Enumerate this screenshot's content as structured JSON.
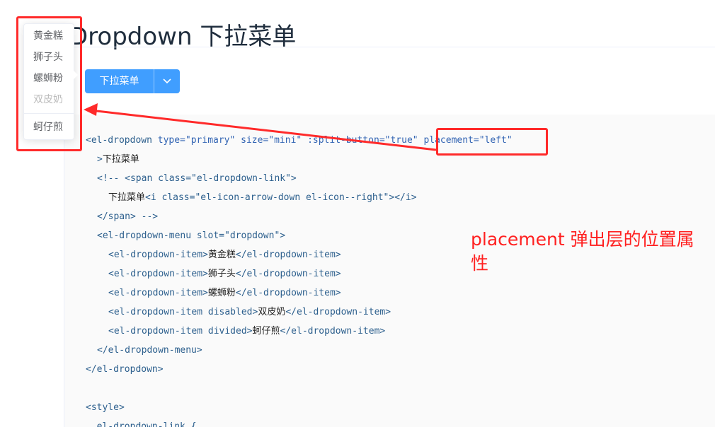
{
  "page": {
    "title": "Dropdown 下拉菜单"
  },
  "button": {
    "label": "下拉菜单"
  },
  "dropdown": {
    "items": [
      {
        "label": "黄金糕"
      },
      {
        "label": "狮子头"
      },
      {
        "label": "螺蛳粉"
      },
      {
        "label": "双皮奶",
        "disabled": true
      },
      {
        "label": "蚵仔煎",
        "divided": true
      }
    ]
  },
  "code": {
    "line1_tag": "<el-dropdown ",
    "line1_attrs": "type=\"primary\" size=\"mini\" :split-button=\"true\" ",
    "line1_placement": "placement=\"left\"",
    "line2_tag": ">",
    "line2_text": "下拉菜单",
    "line3": "<!-- <span class=\"el-dropdown-link\">",
    "line4_text": "下拉菜单",
    "line4_code": "<i class=\"el-icon-arrow-down el-icon--right\"></i>",
    "line5": "</span> -->",
    "line6": "<el-dropdown-menu slot=\"dropdown\">",
    "items": [
      {
        "open": "<el-dropdown-item>",
        "text": "黄金糕",
        "close": "</el-dropdown-item>"
      },
      {
        "open": "<el-dropdown-item>",
        "text": "狮子头",
        "close": "</el-dropdown-item>"
      },
      {
        "open": "<el-dropdown-item>",
        "text": "螺蛳粉",
        "close": "</el-dropdown-item>"
      },
      {
        "open": "<el-dropdown-item disabled>",
        "text": "双皮奶",
        "close": "</el-dropdown-item>"
      },
      {
        "open": "<el-dropdown-item divided>",
        "text": "蚵仔煎",
        "close": "</el-dropdown-item>"
      }
    ],
    "line12": "</el-dropdown-menu>",
    "line13": "</el-dropdown>",
    "line15": "<style>",
    "line16": "  el-dropdown-link {"
  },
  "annotation": {
    "text": "placement 弹出层的位置属性"
  },
  "colors": {
    "primary": "#409eff",
    "annotation_red": "#ff2020"
  }
}
